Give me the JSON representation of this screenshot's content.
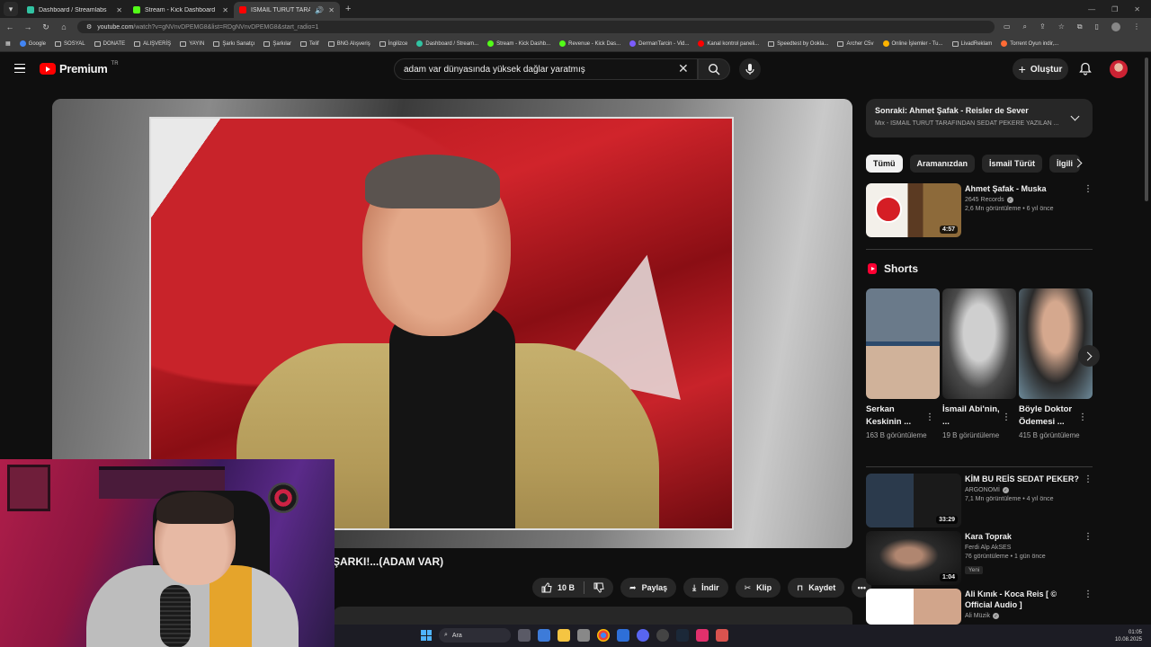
{
  "browser": {
    "tabs": [
      {
        "label": "Dashboard / Streamlabs",
        "color": "#31c3a2",
        "active": false
      },
      {
        "label": "Stream - Kick Dashboard",
        "color": "#53fc18",
        "active": false
      },
      {
        "label": "İSMAİL TÜRÜT TARAFINDAN",
        "color": "#ff0000",
        "active": true
      }
    ],
    "url_main": "youtube.com",
    "url_rest": "/watch?v=gNVnvDPEMG8&list=RDgNVnvDPEMG8&start_radio=1",
    "bookmarks": [
      "Google",
      "SOSYAL",
      "DONATE",
      "ALIŞVERİŞ",
      "YAYIN",
      "Şarkı Sanatçı",
      "Şarkılar",
      "Telif",
      "BNG Alışveriş",
      "İngilizce",
      "Dashboard / Stream...",
      "Stream - Kick Dashb...",
      "Revenue - Kick Das...",
      "DermanTarcin - Vid...",
      "Kanal kontrol paneli...",
      "Speedtest by Ookla...",
      "Archer C5v",
      "Online İşlemler - Tu...",
      "LivadReklam",
      "Torrent Oyun indir,..."
    ]
  },
  "youtube": {
    "logo_text": "Premium",
    "logo_region": "TR",
    "search_value": "adam var dünyasında yüksek dağlar yaratmış",
    "create_label": "Oluştur"
  },
  "video": {
    "title_visible": "ŞARKI!...(ADAM VAR)",
    "like_count": "10 B",
    "share_label": "Paylaş",
    "download_label": "İndir",
    "clip_label": "Klip",
    "save_label": "Kaydet"
  },
  "sidebar": {
    "up_next_title": "Sonraki: Ahmet Şafak - Reisler de Sever",
    "up_next_sub": "Mix - İSMAİL TÜRÜT TARAFINDAN SEDAT PEKERE YAZILAN ...",
    "chips": [
      "Tümü",
      "Aramanızdan",
      "İsmail Türüt",
      "İlgili"
    ],
    "first_video": {
      "title": "Ahmet Şafak - Muska",
      "channel": "2645 Records",
      "meta": "2,6 Mn görüntüleme • 6 yıl önce",
      "duration": "4:57"
    },
    "shorts_title": "Shorts",
    "shorts": [
      {
        "title": "Serkan Keskinin ...",
        "views": "163 B görüntüleme"
      },
      {
        "title": "İsmail Abi'nin, ...",
        "views": "19 B görüntüleme"
      },
      {
        "title": "Böyle Doktor Ödemesi ...",
        "views": "415 B görüntüleme"
      }
    ],
    "videos": [
      {
        "title": "KİM BU REİS SEDAT PEKER?",
        "channel": "ARGONOMİ",
        "meta": "7,1 Mn görüntüleme • 4 yıl önce",
        "duration": "33:29",
        "badge": ""
      },
      {
        "title": "Kara Toprak",
        "channel": "Ferdi Alp AkSES",
        "meta": "76 görüntüleme • 1 gün önce",
        "duration": "1:04",
        "badge": "Yeni"
      },
      {
        "title": "Ali Kınık - Koca Reis [ © Official Audio ]",
        "channel": "Ali Müzik",
        "meta": "",
        "duration": "",
        "badge": ""
      }
    ]
  },
  "taskbar": {
    "search_placeholder": "Ara",
    "time": "01:05",
    "date": "10.08.2025"
  }
}
